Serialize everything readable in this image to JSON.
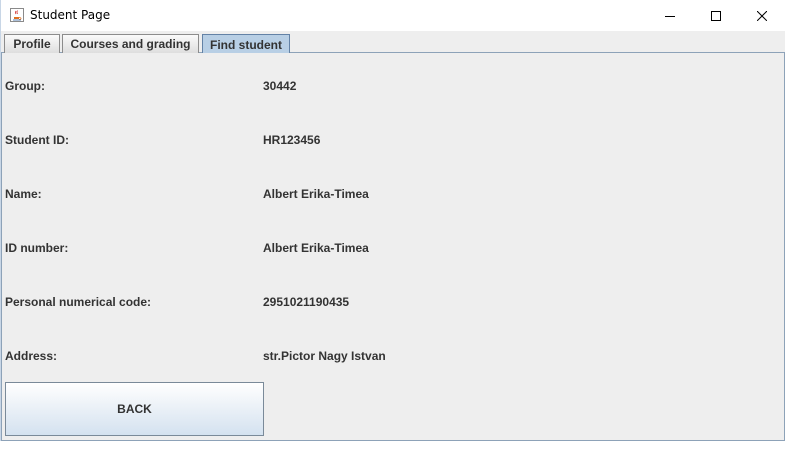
{
  "window": {
    "title": "Student Page",
    "icon": "java-cup-icon",
    "controls": [
      "minimize-icon",
      "maximize-icon",
      "close-icon"
    ]
  },
  "tabs": [
    {
      "label": "Profile",
      "selected": false
    },
    {
      "label": "Courses and grading",
      "selected": false
    },
    {
      "label": "Find student",
      "selected": true
    }
  ],
  "fields": [
    {
      "label": "Group:",
      "value": "30442"
    },
    {
      "label": "Student ID:",
      "value": "HR123456"
    },
    {
      "label": "Name:",
      "value": "Albert Erika-Timea"
    },
    {
      "label": "ID number:",
      "value": "Albert Erika-Timea"
    },
    {
      "label": "Personal numerical code:",
      "value": "2951021190435"
    },
    {
      "label": "Address:",
      "value": "str.Pictor Nagy Istvan"
    }
  ],
  "actions": {
    "back_label": "BACK"
  },
  "colors": {
    "selected_tab": "#b8cfe5",
    "panel_background": "#eeeeee",
    "border": "#8da2b8"
  }
}
